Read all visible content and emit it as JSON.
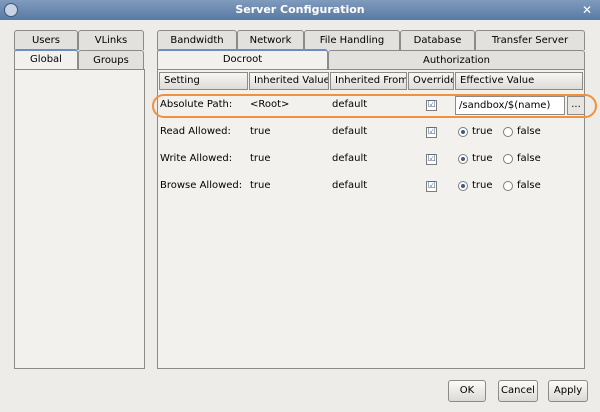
{
  "window": {
    "title": "Server Configuration",
    "close_glyph": "✕"
  },
  "left_tabs": {
    "row1": [
      "Users",
      "VLinks"
    ],
    "row2": [
      "Global",
      "Groups"
    ]
  },
  "top_tabs": [
    "Bandwidth",
    "Network",
    "File Handling",
    "Database",
    "Transfer Server"
  ],
  "sub_tabs": [
    "Docroot",
    "Authorization"
  ],
  "columns": [
    "Setting",
    "Inherited Value",
    "Inherited From",
    "Override",
    "Effective Value"
  ],
  "rows": [
    {
      "setting": "Absolute Path:",
      "inherited_value": "<Root>",
      "inherited_from": "default",
      "override": true,
      "effective": "/sandbox/$(name)",
      "type": "path"
    },
    {
      "setting": "Read Allowed:",
      "inherited_value": "true",
      "inherited_from": "default",
      "override": true,
      "effective": "true",
      "type": "bool"
    },
    {
      "setting": "Write Allowed:",
      "inherited_value": "true",
      "inherited_from": "default",
      "override": true,
      "effective": "true",
      "type": "bool"
    },
    {
      "setting": "Browse Allowed:",
      "inherited_value": "true",
      "inherited_from": "default",
      "override": true,
      "effective": "true",
      "type": "bool"
    }
  ],
  "radio_labels": {
    "true": "true",
    "false": "false"
  },
  "ellipsis_label": "...",
  "check_glyph": "☑",
  "buttons": {
    "ok": "OK",
    "cancel": "Cancel",
    "apply": "Apply"
  },
  "colors": {
    "titlebar": "#6a88ae",
    "highlight": "#f0913e",
    "tab_accent": "#6d8dbf"
  },
  "icons": {
    "window": "app-icon",
    "close": "close-icon",
    "checkbox": "checkbox-checked-icon"
  }
}
